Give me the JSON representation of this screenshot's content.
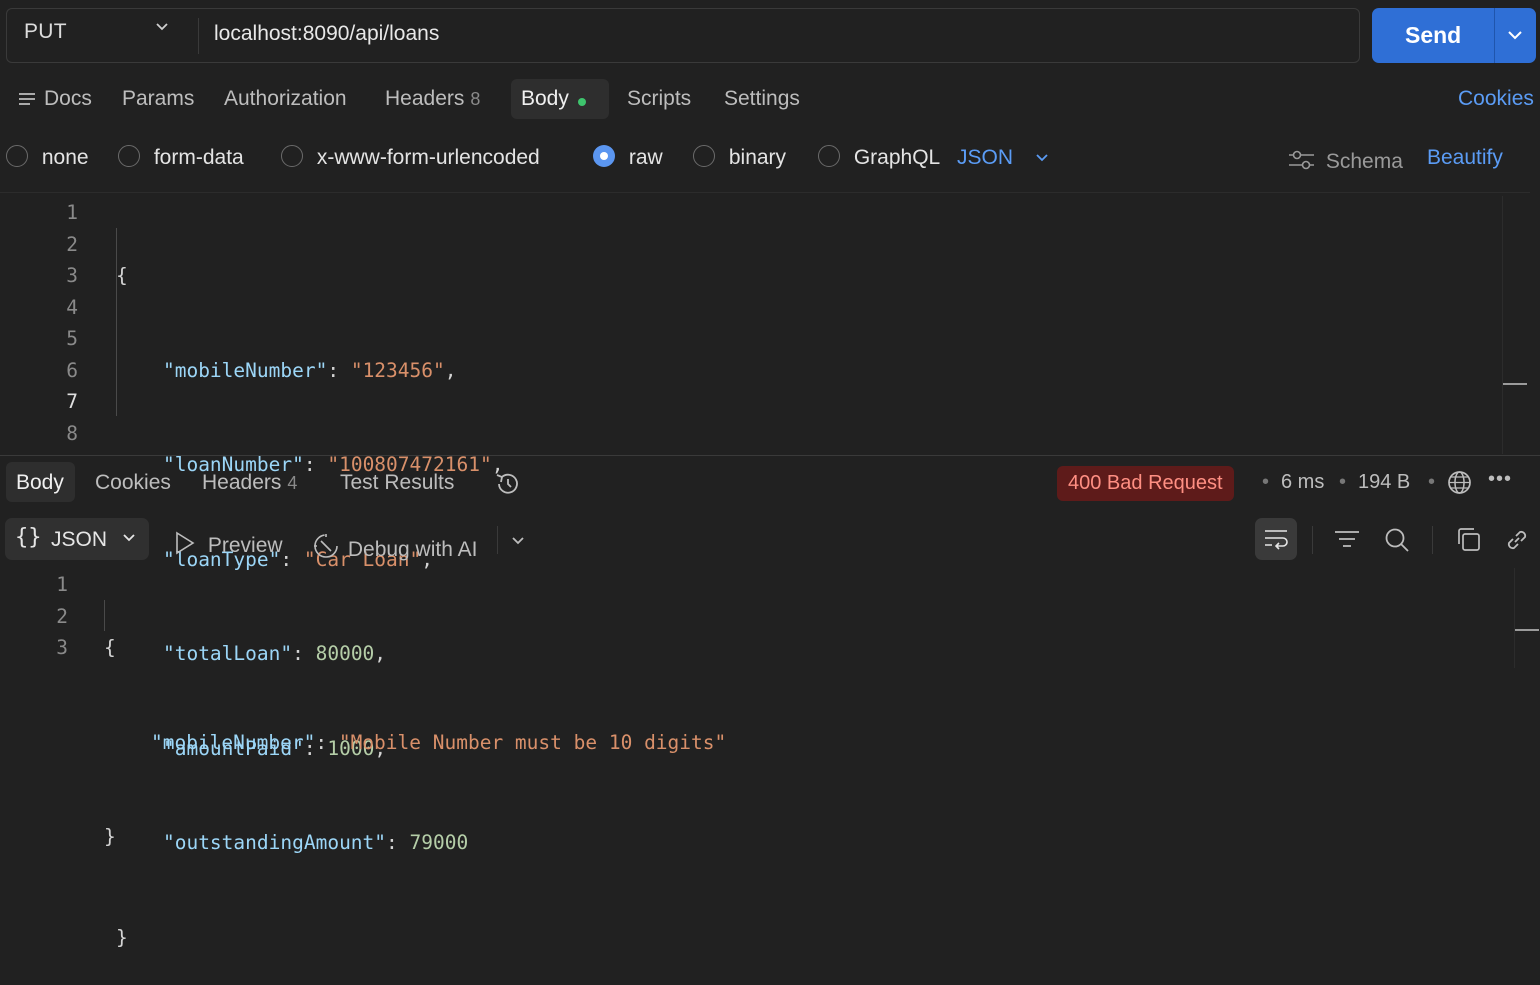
{
  "request": {
    "method": "PUT",
    "url": "localhost:8090/api/loans",
    "send_label": "Send"
  },
  "request_tabs": {
    "docs": "Docs",
    "params": "Params",
    "authorization": "Authorization",
    "headers": "Headers",
    "headers_count": "8",
    "body": "Body",
    "scripts": "Scripts",
    "settings": "Settings",
    "cookies": "Cookies"
  },
  "body_types": {
    "none": "none",
    "form_data": "form-data",
    "urlencoded": "x-www-form-urlencoded",
    "raw": "raw",
    "binary": "binary",
    "graphql": "GraphQL",
    "selected": "raw",
    "language": "JSON",
    "schema": "Schema",
    "beautify": "Beautify"
  },
  "request_body": {
    "line_numbers": [
      "1",
      "2",
      "3",
      "4",
      "5",
      "6",
      "7",
      "8"
    ],
    "open_brace": "{",
    "close_brace": "}",
    "fields": [
      {
        "key": "\"mobileNumber\"",
        "value": "\"123456\"",
        "type": "string"
      },
      {
        "key": "\"loanNumber\"",
        "value": "\"100807472161\"",
        "type": "string"
      },
      {
        "key": "\"loanType\"",
        "value": "\"Car Loan\"",
        "type": "string"
      },
      {
        "key": "\"totalLoan\"",
        "value": "80000",
        "type": "number"
      },
      {
        "key": "\"amountPaid\"",
        "value": "1000",
        "type": "number"
      },
      {
        "key": "\"outstandingAmount\"",
        "value": "79000",
        "type": "number"
      }
    ]
  },
  "response_tabs": {
    "body": "Body",
    "cookies": "Cookies",
    "headers": "Headers",
    "headers_count": "4",
    "test_results": "Test Results"
  },
  "response_meta": {
    "status": "400 Bad Request",
    "time": "6 ms",
    "size": "194 B",
    "more": "•••"
  },
  "response_toolbar": {
    "format": "JSON",
    "preview": "Preview",
    "debug_ai": "Debug with AI"
  },
  "response_body": {
    "line_numbers": [
      "1",
      "2",
      "3"
    ],
    "open_brace": "{",
    "close_brace": "}",
    "key": "\"mobileNumber\"",
    "value": "\"Mobile Number must be 10 digits\""
  },
  "colors": {
    "accent": "#2f6fd6",
    "link": "#5b9cf5",
    "error_bg": "#5e1b1a",
    "error_text": "#ff8f83",
    "success_dot": "#3ec46d"
  }
}
